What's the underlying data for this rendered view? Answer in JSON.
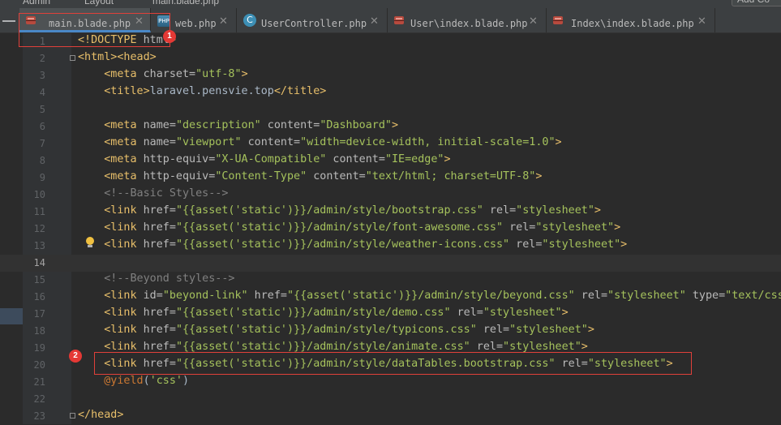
{
  "breadcrumbs": [
    "Admin",
    "Layout",
    "main.blade.php"
  ],
  "search_field": "Add Co",
  "tabs": [
    {
      "label": "main.blade.php",
      "icon": "blade-file-icon",
      "active": true
    },
    {
      "label": "web.php",
      "icon": "php-web-file-icon",
      "active": false
    },
    {
      "label": "UserController.php",
      "icon": "php-class-icon",
      "active": false
    },
    {
      "label": "User\\index.blade.php",
      "icon": "blade-file-icon",
      "active": false
    },
    {
      "label": "Index\\index.blade.php",
      "icon": "blade-file-icon",
      "active": false
    }
  ],
  "close_glyph": "✕",
  "annotations": [
    "1",
    "2"
  ],
  "code_lines": [
    {
      "n": "1",
      "t": [
        [
          "tag",
          "<!DOCTYPE "
        ],
        [
          "attr",
          "html"
        ],
        [
          "tag",
          ">"
        ]
      ]
    },
    {
      "n": "2",
      "t": [
        [
          "tag",
          "<html><head>"
        ]
      ]
    },
    {
      "n": "3",
      "t": [
        [
          "plain",
          "    "
        ],
        [
          "tag",
          "<meta "
        ],
        [
          "attr",
          "charset="
        ],
        [
          "val",
          "\"utf-8\""
        ],
        [
          "tag",
          ">"
        ]
      ]
    },
    {
      "n": "4",
      "t": [
        [
          "plain",
          "    "
        ],
        [
          "tag",
          "<title>"
        ],
        [
          "plain",
          "laravel.pensvie.top"
        ],
        [
          "tag",
          "</title>"
        ]
      ]
    },
    {
      "n": "5",
      "t": []
    },
    {
      "n": "6",
      "t": [
        [
          "plain",
          "    "
        ],
        [
          "tag",
          "<meta "
        ],
        [
          "attr",
          "name="
        ],
        [
          "val",
          "\"description\""
        ],
        [
          "attr",
          " content="
        ],
        [
          "val",
          "\"Dashboard\""
        ],
        [
          "tag",
          ">"
        ]
      ]
    },
    {
      "n": "7",
      "t": [
        [
          "plain",
          "    "
        ],
        [
          "tag",
          "<meta "
        ],
        [
          "attr",
          "name="
        ],
        [
          "val",
          "\"viewport\""
        ],
        [
          "attr",
          " content="
        ],
        [
          "val",
          "\"width=device-width, initial-scale=1.0\""
        ],
        [
          "tag",
          ">"
        ]
      ]
    },
    {
      "n": "8",
      "t": [
        [
          "plain",
          "    "
        ],
        [
          "tag",
          "<meta "
        ],
        [
          "attr",
          "http-equiv="
        ],
        [
          "val",
          "\"X-UA-Compatible\""
        ],
        [
          "attr",
          " content="
        ],
        [
          "val",
          "\"IE=edge\""
        ],
        [
          "tag",
          ">"
        ]
      ]
    },
    {
      "n": "9",
      "t": [
        [
          "plain",
          "    "
        ],
        [
          "tag",
          "<meta "
        ],
        [
          "attr",
          "http-equiv="
        ],
        [
          "val",
          "\"Content-Type\""
        ],
        [
          "attr",
          " content="
        ],
        [
          "val",
          "\"text/html; charset=UTF-8\""
        ],
        [
          "tag",
          ">"
        ]
      ]
    },
    {
      "n": "10",
      "t": [
        [
          "plain",
          "    "
        ],
        [
          "cmt",
          "<!--Basic Styles-->"
        ]
      ]
    },
    {
      "n": "11",
      "t": [
        [
          "plain",
          "    "
        ],
        [
          "tag",
          "<link "
        ],
        [
          "attr",
          "href="
        ],
        [
          "val",
          "\"{{asset('static')}}/admin/style/bootstrap.css\""
        ],
        [
          "attr",
          " rel="
        ],
        [
          "val",
          "\"stylesheet\""
        ],
        [
          "tag",
          ">"
        ]
      ]
    },
    {
      "n": "12",
      "t": [
        [
          "plain",
          "    "
        ],
        [
          "tag",
          "<link "
        ],
        [
          "attr",
          "href="
        ],
        [
          "val",
          "\"{{asset('static')}}/admin/style/font-awesome.css\""
        ],
        [
          "attr",
          " rel="
        ],
        [
          "val",
          "\"stylesheet\""
        ],
        [
          "tag",
          ">"
        ]
      ]
    },
    {
      "n": "13",
      "t": [
        [
          "plain",
          "    "
        ],
        [
          "tag",
          "<link "
        ],
        [
          "attr",
          "href="
        ],
        [
          "val",
          "\"{{asset('static')}}/admin/style/weather-icons.css\""
        ],
        [
          "attr",
          " rel="
        ],
        [
          "val",
          "\"stylesheet\""
        ],
        [
          "tag",
          ">"
        ]
      ]
    },
    {
      "n": "14",
      "t": []
    },
    {
      "n": "15",
      "t": [
        [
          "plain",
          "    "
        ],
        [
          "cmt",
          "<!--Beyond styles-->"
        ]
      ]
    },
    {
      "n": "16",
      "t": [
        [
          "plain",
          "    "
        ],
        [
          "tag",
          "<link "
        ],
        [
          "attr",
          "id="
        ],
        [
          "val",
          "\"beyond-link\""
        ],
        [
          "attr",
          " href="
        ],
        [
          "val",
          "\"{{asset('static')}}/admin/style/beyond.css\""
        ],
        [
          "attr",
          " rel="
        ],
        [
          "val",
          "\"stylesheet\""
        ],
        [
          "attr",
          " type="
        ],
        [
          "val",
          "\"text/css"
        ]
      ]
    },
    {
      "n": "17",
      "t": [
        [
          "plain",
          "    "
        ],
        [
          "tag",
          "<link "
        ],
        [
          "attr",
          "href="
        ],
        [
          "val",
          "\"{{asset('static')}}/admin/style/demo.css\""
        ],
        [
          "attr",
          " rel="
        ],
        [
          "val",
          "\"stylesheet\""
        ],
        [
          "tag",
          ">"
        ]
      ]
    },
    {
      "n": "18",
      "t": [
        [
          "plain",
          "    "
        ],
        [
          "tag",
          "<link "
        ],
        [
          "attr",
          "href="
        ],
        [
          "val",
          "\"{{asset('static')}}/admin/style/typicons.css\""
        ],
        [
          "attr",
          " rel="
        ],
        [
          "val",
          "\"stylesheet\""
        ],
        [
          "tag",
          ">"
        ]
      ]
    },
    {
      "n": "19",
      "t": [
        [
          "plain",
          "    "
        ],
        [
          "tag",
          "<link "
        ],
        [
          "attr",
          "href="
        ],
        [
          "val",
          "\"{{asset('static')}}/admin/style/animate.css\""
        ],
        [
          "attr",
          " rel="
        ],
        [
          "val",
          "\"stylesheet\""
        ],
        [
          "tag",
          ">"
        ]
      ]
    },
    {
      "n": "20",
      "t": [
        [
          "plain",
          "    "
        ],
        [
          "tag",
          "<link "
        ],
        [
          "attr",
          "href="
        ],
        [
          "val",
          "\"{{asset('static')}}/admin/style/dataTables.bootstrap.css\""
        ],
        [
          "attr",
          " rel="
        ],
        [
          "val",
          "\"stylesheet\""
        ],
        [
          "tag",
          ">"
        ]
      ]
    },
    {
      "n": "21",
      "t": [
        [
          "plain",
          "    "
        ],
        [
          "blade",
          "@yield"
        ],
        [
          "plain",
          "("
        ],
        [
          "val",
          "'css'"
        ],
        [
          "plain",
          ")"
        ]
      ]
    },
    {
      "n": "22",
      "t": []
    },
    {
      "n": "23",
      "t": [
        [
          "tag",
          "</head>"
        ]
      ]
    }
  ],
  "current_line": "14",
  "colors": {
    "editor_bg": "#2b2b2b",
    "gutter_bg": "#313335",
    "tag": "#e8bf6a",
    "attribute": "#bababa",
    "string": "#a5c25c",
    "comment": "#808080",
    "directive": "#cc7832",
    "annotation_red": "#e53935"
  }
}
